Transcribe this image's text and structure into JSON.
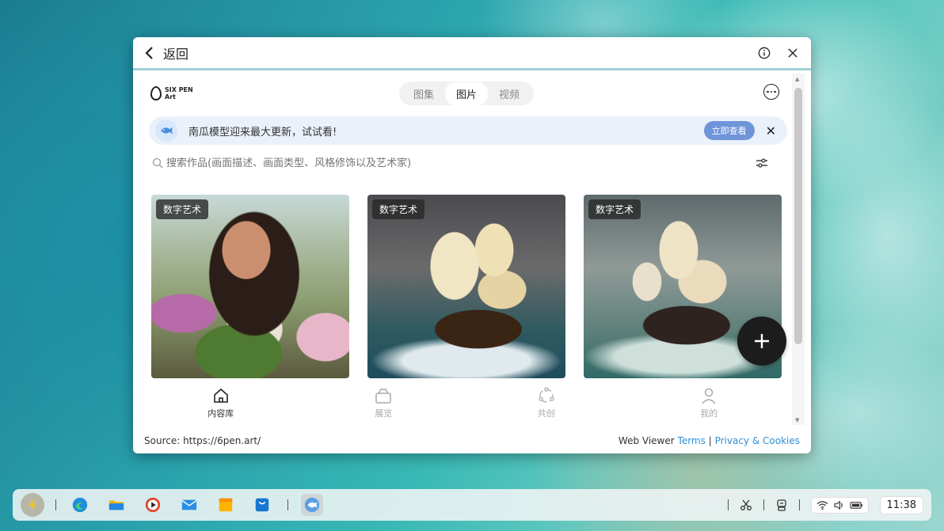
{
  "window": {
    "back_label": "返回",
    "logo_text_line1": "SIX PEN",
    "logo_text_line2": "Art"
  },
  "tabs": [
    {
      "label": "图集",
      "active": false
    },
    {
      "label": "图片",
      "active": true
    },
    {
      "label": "视频",
      "active": false
    }
  ],
  "banner": {
    "text": "南瓜模型迎来最大更新，试试看!",
    "button_label": "立即查看"
  },
  "search": {
    "placeholder": "搜索作品(画面描述、画面类型、风格修饰以及艺术家)"
  },
  "cards": [
    {
      "tag": "数字艺术"
    },
    {
      "tag": "数字艺术"
    },
    {
      "tag": "数字艺术"
    }
  ],
  "nav": [
    {
      "label": "内容库",
      "icon": "home-icon",
      "active": true
    },
    {
      "label": "展览",
      "icon": "gallery-icon",
      "active": false
    },
    {
      "label": "共创",
      "icon": "cocreate-icon",
      "active": false
    },
    {
      "label": "我的",
      "icon": "person-icon",
      "active": false
    }
  ],
  "footer": {
    "source": "Source: https://6pen.art/",
    "viewer": "Web Viewer",
    "terms": "Terms",
    "divider": "|",
    "privacy": "Privacy & Cookies"
  },
  "taskbar": {
    "clock": "11:38"
  },
  "colors": {
    "accent": "#6f94d8",
    "banner_bg": "#eaf1fb",
    "link": "#2f8fd8"
  }
}
